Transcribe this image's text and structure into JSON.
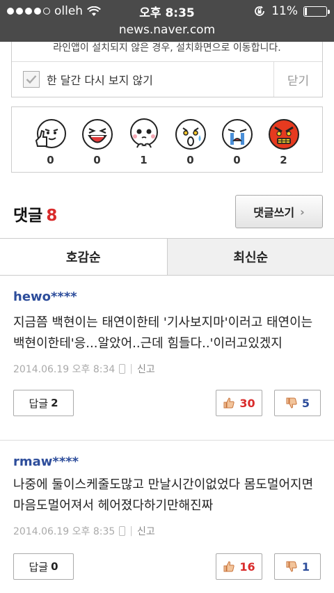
{
  "status": {
    "carrier": "olleh",
    "time": "오후 8:35",
    "battery": "11%",
    "battery_level": 0.11
  },
  "browser": {
    "url": "news.naver.com"
  },
  "banner": {
    "message": "라인앱이 설치되지 않은 경우, 설치화면으로 이동합니다.",
    "checkbox_label": "한 달간 다시 보지 않기",
    "close_label": "닫기"
  },
  "reactions": [
    {
      "icon": "like-face-icon",
      "count": "0"
    },
    {
      "icon": "laugh-face-icon",
      "count": "0"
    },
    {
      "icon": "pleading-face-icon",
      "count": "1"
    },
    {
      "icon": "scared-face-icon",
      "count": "0"
    },
    {
      "icon": "crying-face-icon",
      "count": "0"
    },
    {
      "icon": "angry-face-icon",
      "count": "2"
    }
  ],
  "comments_header": {
    "title": "댓글",
    "count": "8",
    "write_label": "댓글쓰기"
  },
  "tabs": [
    {
      "label": "호감순",
      "active": true
    },
    {
      "label": "최신순",
      "active": false
    }
  ],
  "comments": [
    {
      "user": "hewo****",
      "body": "지금쯤 백현이는 태연이한테 '기사보지마'이러고 태연이는 백현이한테'응...알았어..근데 힘들다..'이러고있겠지",
      "date": "2014.06.19 오후 8:34",
      "report": "신고",
      "reply_label": "답글",
      "reply_count": "2",
      "likes": "30",
      "dislikes": "5"
    },
    {
      "user": "rmaw****",
      "body": "나중에 둘이스케줄도많고 만날시간이없었다 몸도멀어지면마음도멀어져서 헤어졌다하기만해진짜",
      "date": "2014.06.19 오후 8:35",
      "report": "신고",
      "reply_label": "답글",
      "reply_count": "0",
      "likes": "16",
      "dislikes": "1"
    }
  ],
  "colors": {
    "accent_red": "#d92b2b",
    "user_blue": "#2d4d9b",
    "topbar": "#4a4a4a"
  }
}
